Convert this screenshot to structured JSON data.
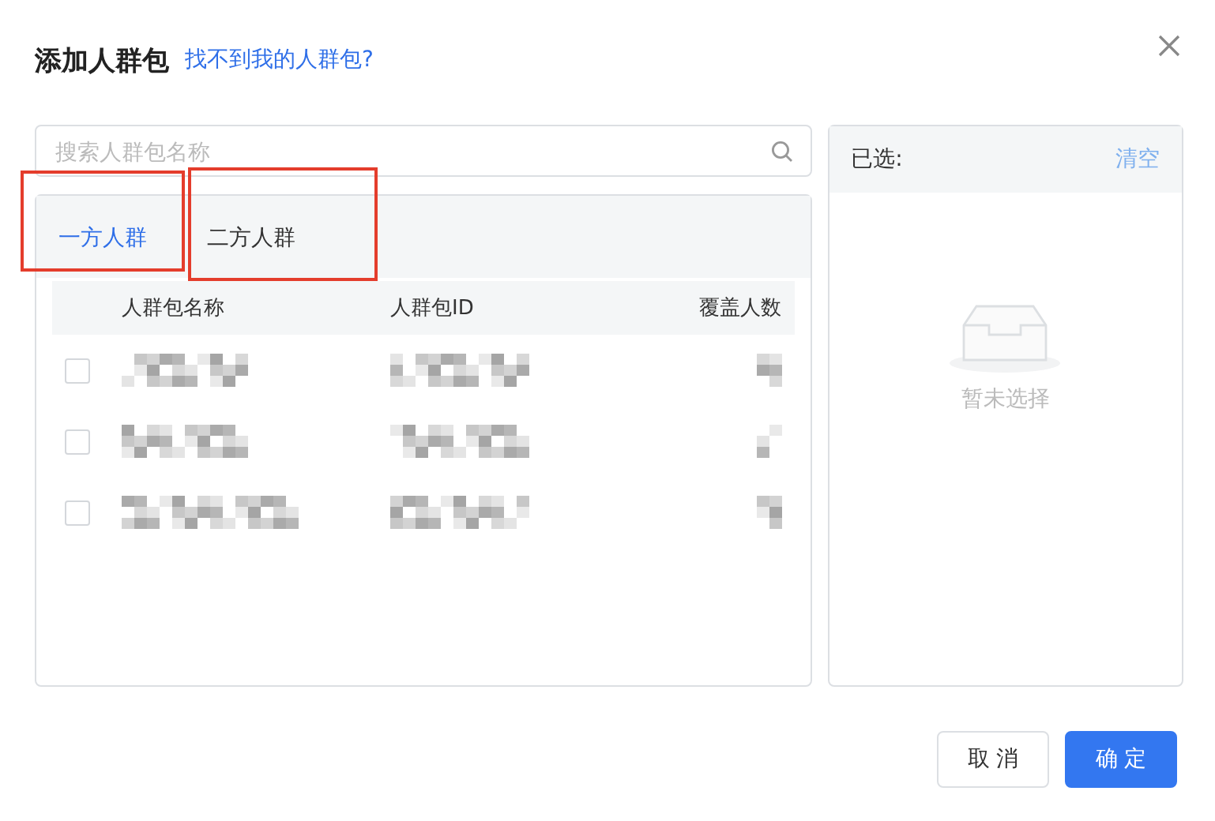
{
  "dialog": {
    "title": "添加人群包",
    "help_link": "找不到我的人群包?"
  },
  "search": {
    "placeholder": "搜索人群包名称"
  },
  "tabs": [
    {
      "label": "一方人群",
      "selected": true,
      "highlighted": true
    },
    {
      "label": "二方人群",
      "selected": false,
      "highlighted": true
    }
  ],
  "table": {
    "columns": [
      "人群包名称",
      "人群包ID",
      "覆盖人数"
    ],
    "rows": [
      {
        "checked": false
      },
      {
        "checked": false
      },
      {
        "checked": false
      }
    ]
  },
  "selected_panel": {
    "title": "已选:",
    "clear": "清空",
    "empty_text": "暂未选择"
  },
  "buttons": {
    "cancel": "取 消",
    "ok": "确 定"
  }
}
